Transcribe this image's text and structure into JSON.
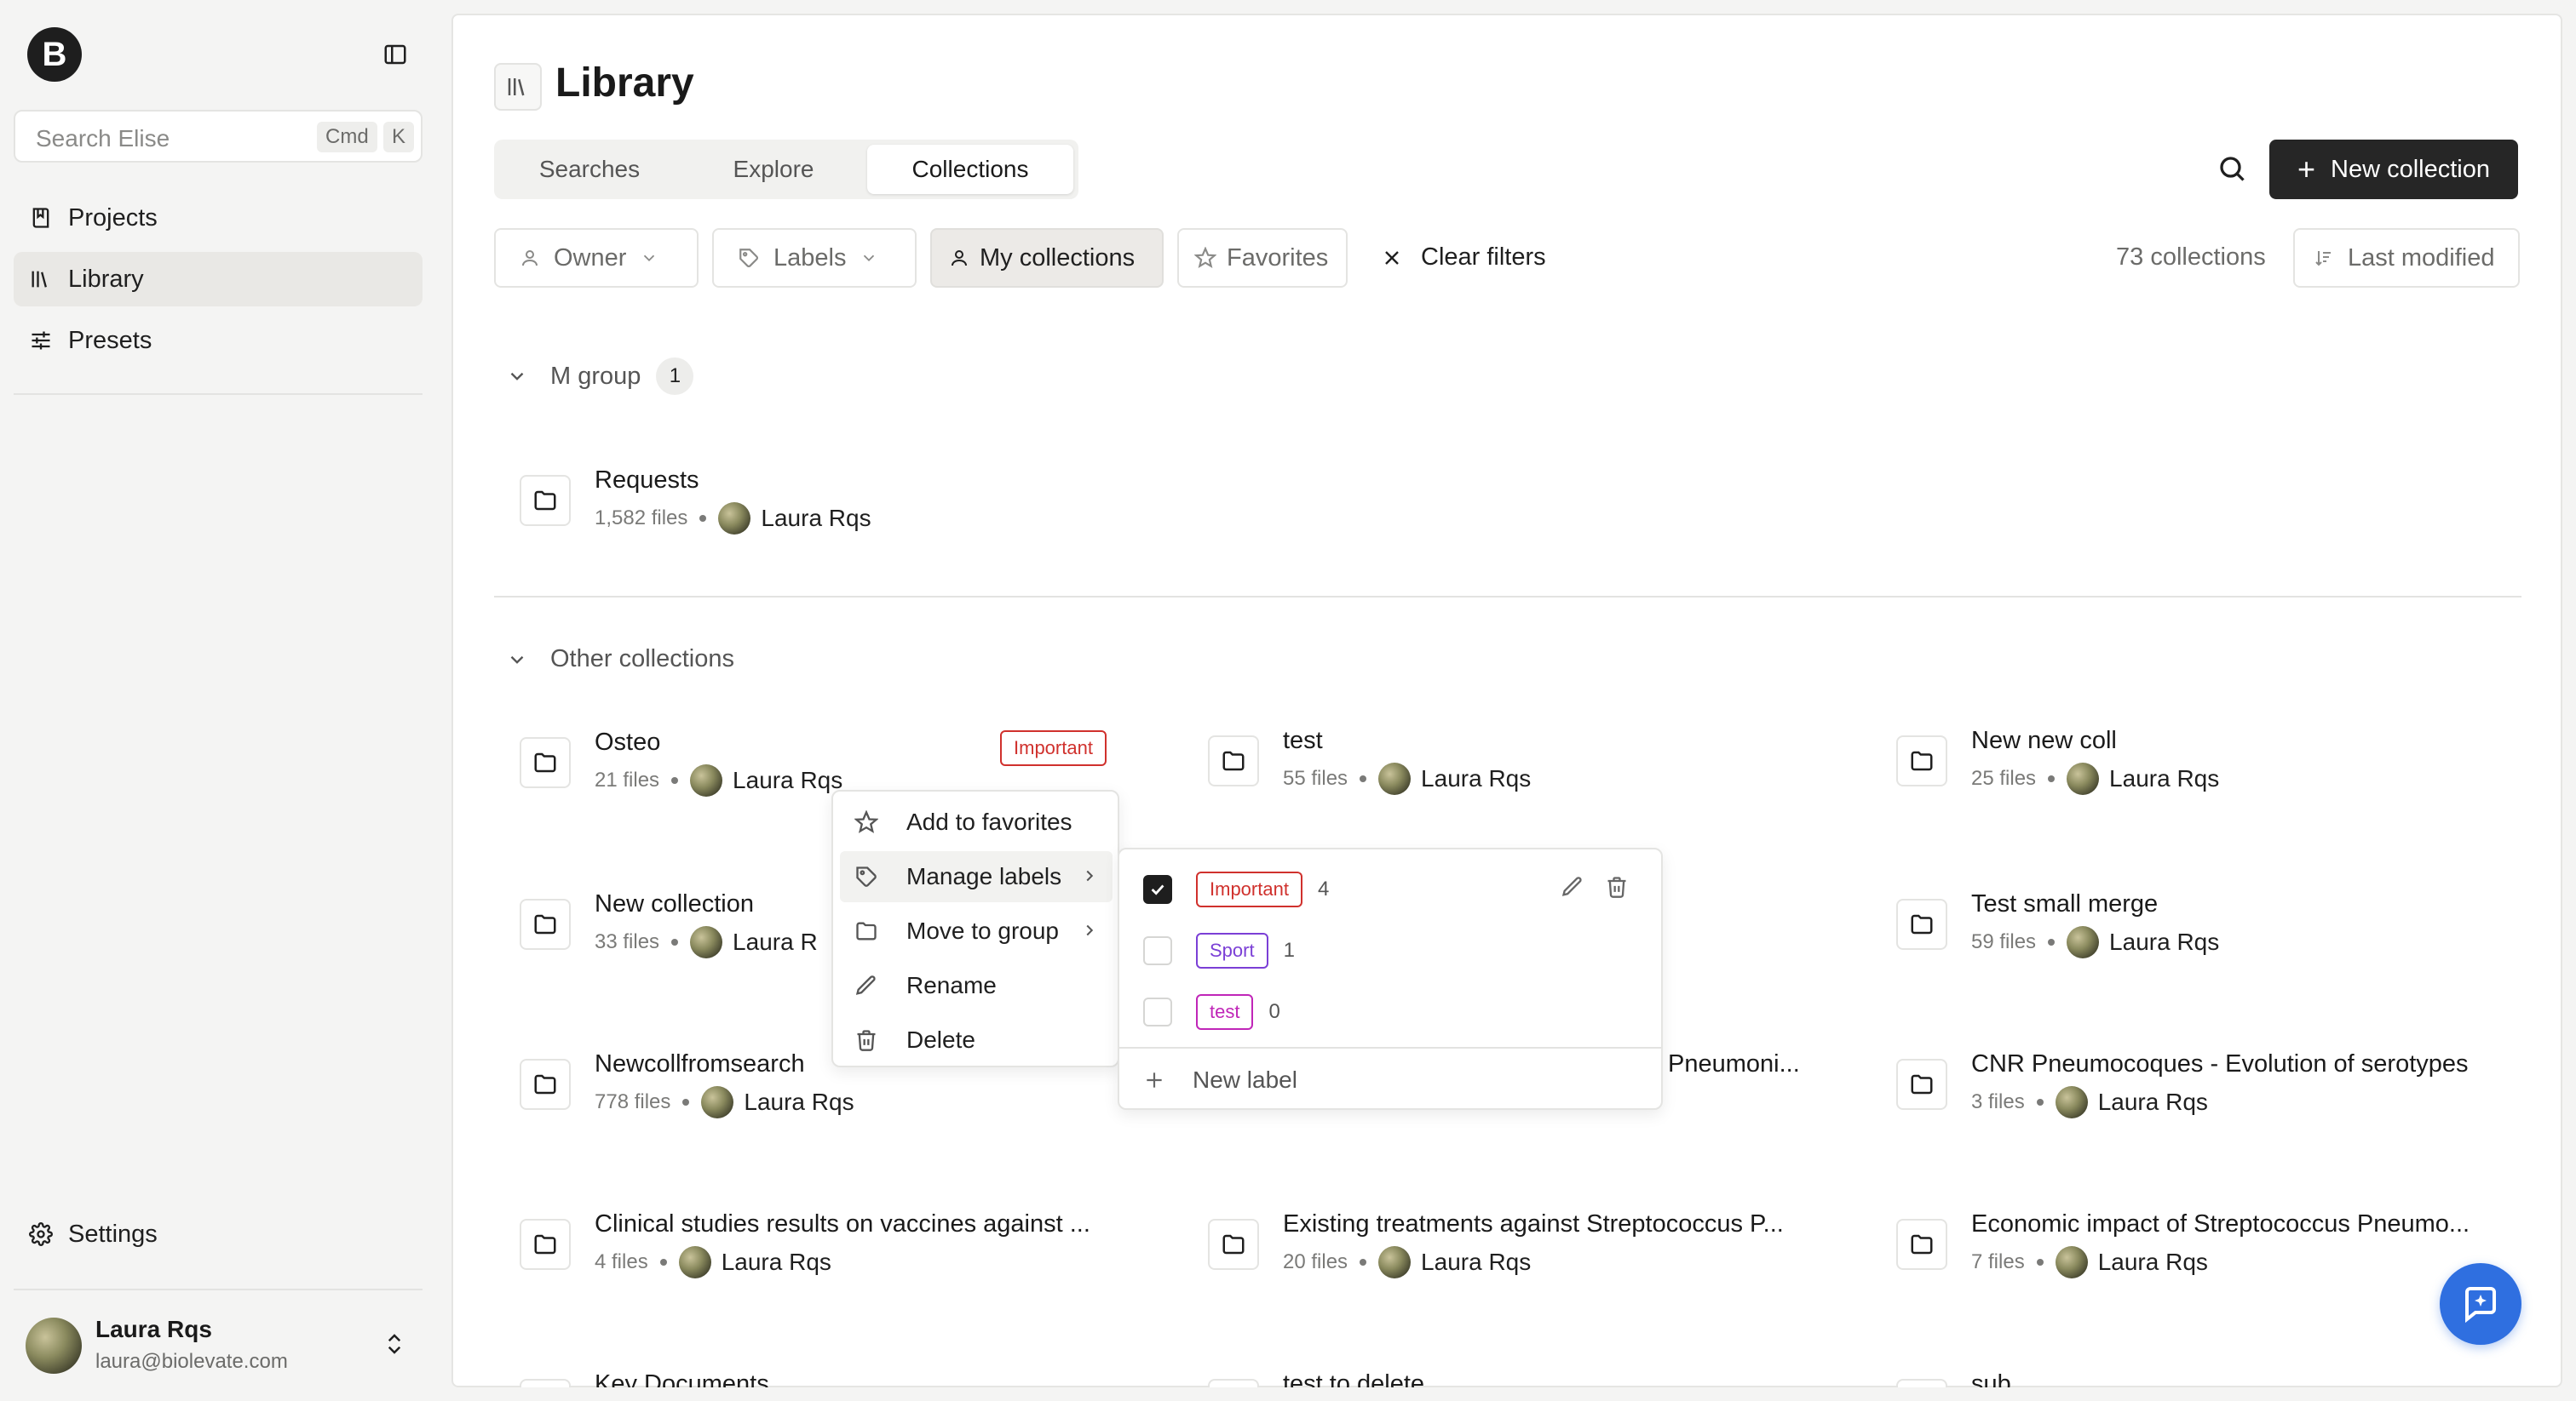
{
  "sidebar": {
    "logo_letter": "B",
    "search_placeholder": "Search Elise",
    "shortcut_cmd": "Cmd",
    "shortcut_key": "K",
    "nav": [
      {
        "label": "Projects",
        "icon": "book-icon"
      },
      {
        "label": "Library",
        "icon": "library-icon",
        "active": true
      },
      {
        "label": "Presets",
        "icon": "sliders-icon"
      }
    ],
    "settings_label": "Settings",
    "user": {
      "name": "Laura Rqs",
      "email": "laura@biolevate.com"
    }
  },
  "header": {
    "title": "Library",
    "tabs": [
      "Searches",
      "Explore",
      "Collections"
    ],
    "active_tab": "Collections",
    "new_collection_label": "New collection"
  },
  "filters": {
    "owner": "Owner",
    "labels": "Labels",
    "my_collections": "My collections",
    "favorites": "Favorites",
    "clear": "Clear filters",
    "count_text": "73 collections",
    "sort": "Last modified"
  },
  "groups": [
    {
      "name": "M group",
      "count": "1",
      "collections": [
        {
          "name": "Requests",
          "files": "1,582 files",
          "owner": "Laura Rqs"
        }
      ]
    },
    {
      "name": "Other collections",
      "collections": [
        {
          "name": "Osteo",
          "files": "21 files",
          "owner": "Laura Rqs",
          "label": "Important"
        },
        {
          "name": "test",
          "files": "55 files",
          "owner": "Laura Rqs"
        },
        {
          "name": "New new coll",
          "files": "25 files",
          "owner": "Laura Rqs"
        },
        {
          "name": "New collection",
          "files": "33 files",
          "owner": "Laura R"
        },
        {
          "name": "Test small merge",
          "files": "59 files",
          "owner": "Laura Rqs"
        },
        {
          "name": "Newcollfromsearch",
          "files": "778 files",
          "owner": "Laura Rqs"
        },
        {
          "name": "Pneumoni...",
          "files": "",
          "owner": ""
        },
        {
          "name": "CNR Pneumocoques - Evolution of serotypes",
          "files": "3 files",
          "owner": "Laura Rqs"
        },
        {
          "name": "Clinical studies results on vaccines against ...",
          "files": "4 files",
          "owner": "Laura Rqs"
        },
        {
          "name": "Existing treatments against Streptococcus P...",
          "files": "20 files",
          "owner": "Laura Rqs"
        },
        {
          "name": "Economic impact of Streptococcus Pneumo...",
          "files": "7 files",
          "owner": "Laura Rqs"
        },
        {
          "name": "Key Documents",
          "files": "",
          "owner": ""
        },
        {
          "name": "test to delete",
          "files": "",
          "owner": ""
        },
        {
          "name": "sub",
          "files": "",
          "owner": ""
        }
      ]
    }
  ],
  "context_menu": {
    "items": [
      "Add to favorites",
      "Manage labels",
      "Move to group",
      "Rename",
      "Delete"
    ]
  },
  "labels_menu": {
    "labels": [
      {
        "name": "Important",
        "count": "4",
        "checked": true,
        "color": "#d0312d"
      },
      {
        "name": "Sport",
        "count": "1",
        "checked": false,
        "color": "#7b3fd6"
      },
      {
        "name": "test",
        "count": "0",
        "checked": false,
        "color": "#c026b8"
      }
    ],
    "new_label": "New label"
  },
  "colors": {
    "primary": "#262626",
    "fab": "#2f6fe0",
    "important": "#d0312d",
    "sport": "#7b3fd6",
    "test": "#c026b8"
  }
}
